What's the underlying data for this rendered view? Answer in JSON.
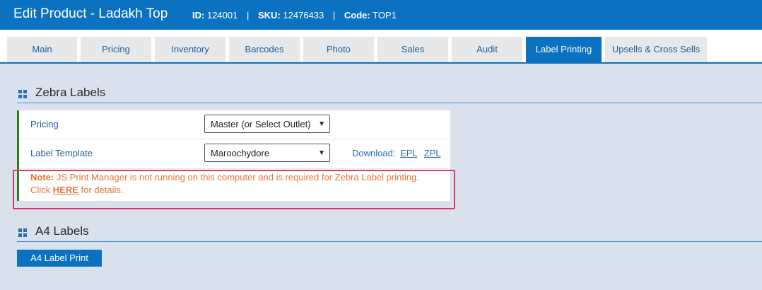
{
  "header": {
    "title": "Edit Product - Ladakh Top",
    "id_label": "ID:",
    "id_value": "124001",
    "sku_label": "SKU:",
    "sku_value": "12476433",
    "code_label": "Code:",
    "code_value": "TOP1",
    "separator": "|"
  },
  "tabs": [
    {
      "label": "Main"
    },
    {
      "label": "Pricing"
    },
    {
      "label": "Inventory"
    },
    {
      "label": "Barcodes"
    },
    {
      "label": "Photo"
    },
    {
      "label": "Sales"
    },
    {
      "label": "Audit"
    },
    {
      "label": "Label Printing"
    },
    {
      "label": "Upsells & Cross Sells"
    }
  ],
  "zebra": {
    "title": "Zebra Labels",
    "pricing_label": "Pricing",
    "pricing_value": "Master (or Select Outlet)",
    "template_label": "Label Template",
    "template_value": "Maroochydore",
    "download_label": "Download:",
    "epl": "EPL",
    "zpl": "ZPL",
    "note_prefix": "Note:",
    "note_text": "JS Print Manager is not running on this computer and is required for Zebra Label printing. Click",
    "note_link": "HERE",
    "note_suffix": "for details."
  },
  "a4": {
    "title": "A4 Labels",
    "button": "A4 Label Print"
  },
  "colors": {
    "accent": "#0a72c1",
    "warning": "#e8753a",
    "highlight_border": "#d43a6c",
    "panel_border": "#2f7f1c"
  },
  "icons": {
    "section": "grid-icon",
    "dropdown": "chevron-down-icon"
  }
}
